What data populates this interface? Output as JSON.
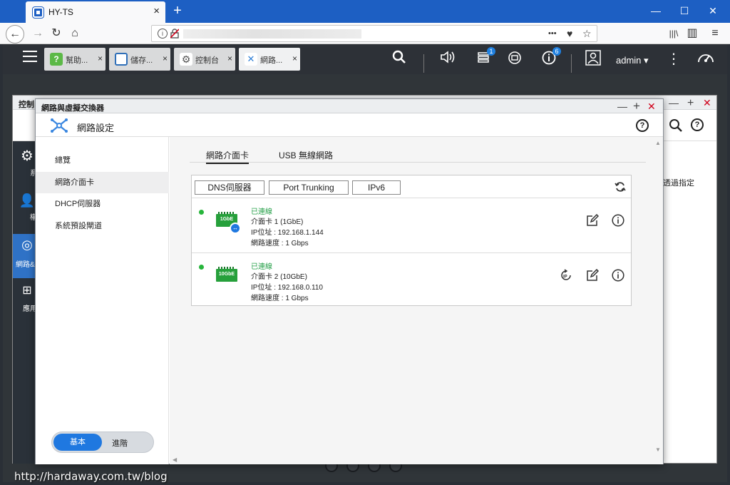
{
  "browser": {
    "tab_title": "HY-TS",
    "new_tab": "+",
    "window_controls": {
      "minimize": "—",
      "maximize": "☐",
      "close": "✕"
    },
    "nav": {
      "back": "←",
      "forward": "→",
      "reload": "↻",
      "home": "⌂"
    },
    "url_actions": {
      "more": "•••",
      "pocket": "♥",
      "bookmark": "☆"
    },
    "right_tools": {
      "library": "|||\\",
      "sidebar": "▥",
      "menu": "≡"
    }
  },
  "qts_bar": {
    "tabs": [
      {
        "label": "幫助...",
        "icon_color": "#5cb947"
      },
      {
        "label": "儲存...",
        "icon_color": "#2f6fb8"
      },
      {
        "label": "控制台",
        "icon_color": "#6b7480"
      },
      {
        "label": "網路...",
        "icon_color": "#2f7fd6"
      }
    ],
    "tab_close": "×",
    "notification_badge_1": "1",
    "notification_badge_2": "6",
    "user": "admin ▾",
    "more": "⋮"
  },
  "control_panel": {
    "title": "控制",
    "side_items": [
      "系",
      "權",
      "網路&",
      "應用"
    ],
    "right_text": "透過指定"
  },
  "network_window": {
    "title": "網路與虛擬交換器",
    "header_label": "網路設定",
    "help": "?",
    "controls": {
      "minimize": "—",
      "maximize": "+",
      "close": "✕"
    },
    "nav": [
      "總覽",
      "網路介面卡",
      "DHCP伺服器",
      "系統預設閘道"
    ],
    "mode_toggle": {
      "basic": "基本",
      "advanced": "進階"
    },
    "subtabs": [
      "網路介面卡",
      "USB 無線網路"
    ],
    "buttons": [
      "DNS伺服器",
      "Port Trunking",
      "IPv6"
    ],
    "adapters": [
      {
        "status": "已連線",
        "name": "介面卡 1 (1GbE)",
        "ip": "IP位址 : 192.168.1.144",
        "speed": "網路速度 : 1 Gbps",
        "nic_label": "1GbE",
        "status_color": "#27b53b"
      },
      {
        "status": "已連線",
        "name": "介面卡 2 (10GbE)",
        "ip": "IP位址 : 192.168.0.110",
        "speed": "網路速度 : 1 Gbps",
        "nic_label": "10GbE",
        "status_color": "#27b53b"
      }
    ]
  },
  "watermark": "http://hardaway.com.tw/blog"
}
